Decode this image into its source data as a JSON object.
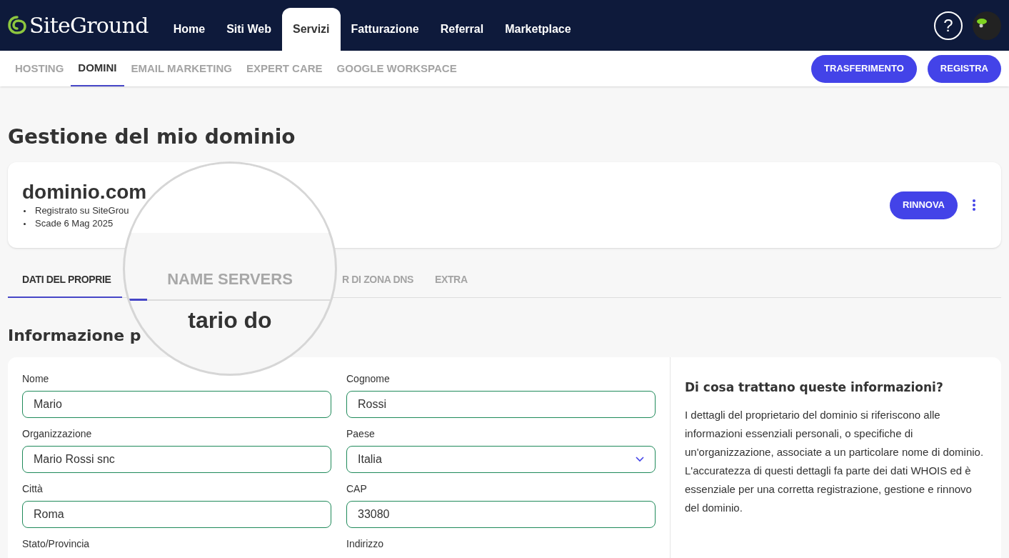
{
  "header": {
    "logo": "SiteGround",
    "nav": [
      {
        "label": "Home",
        "selected": false
      },
      {
        "label": "Siti Web",
        "selected": false
      },
      {
        "label": "Servizi",
        "selected": true
      },
      {
        "label": "Fatturazione",
        "selected": false
      },
      {
        "label": "Referral",
        "selected": false
      },
      {
        "label": "Marketplace",
        "selected": false
      }
    ],
    "help": "?"
  },
  "subnav": {
    "tabs": [
      {
        "label": "HOSTING",
        "selected": false
      },
      {
        "label": "DOMINI",
        "selected": true
      },
      {
        "label": "EMAIL MARKETING",
        "selected": false
      },
      {
        "label": "EXPERT CARE",
        "selected": false
      },
      {
        "label": "GOOGLE WORKSPACE",
        "selected": false
      }
    ],
    "buttons": [
      "TRASFERIMENTO",
      "REGISTRA"
    ]
  },
  "page_title": "Gestione del mio dominio",
  "domain_card": {
    "name": "dominio.com",
    "details": [
      "Registrato su SiteGrou",
      "Scade 6 Mag 2025"
    ],
    "renew_button": "RINNOVA"
  },
  "domain_tabs": [
    {
      "label": "DATI DEL PROPRIE",
      "selected": true
    },
    {
      "label": "R DI ZONA DNS",
      "selected": false
    },
    {
      "label": "EXTRA",
      "selected": false
    }
  ],
  "magnifier": {
    "tab_label": "NAME SERVERS",
    "heading_fragment": "tario do"
  },
  "section_heading": "Informazione p",
  "form": {
    "fields": [
      {
        "label": "Nome",
        "value": "Mario",
        "kind": "text"
      },
      {
        "label": "Cognome",
        "value": "Rossi",
        "kind": "text"
      },
      {
        "label": "Organizzazione",
        "value": "Mario Rossi snc",
        "kind": "text"
      },
      {
        "label": "Paese",
        "value": "Italia",
        "kind": "select"
      },
      {
        "label": "Città",
        "value": "Roma",
        "kind": "text"
      },
      {
        "label": "CAP",
        "value": "33080",
        "kind": "text"
      },
      {
        "label": "Stato/Provincia",
        "kind": "cut"
      },
      {
        "label": "Indirizzo",
        "kind": "cut"
      }
    ]
  },
  "info": {
    "title": "Di cosa trattano queste informazioni?",
    "body": "I dettagli del proprietario del dominio si riferiscono alle informazioni essenziali personali, o specifiche di un'organizzazione, associate a un particolare nome di dominio. L'accuratezza di questi dettagli fa parte dei dati WHOIS ed è essenziale per una corretta registrazione, gestione e rinnovo del dominio."
  }
}
